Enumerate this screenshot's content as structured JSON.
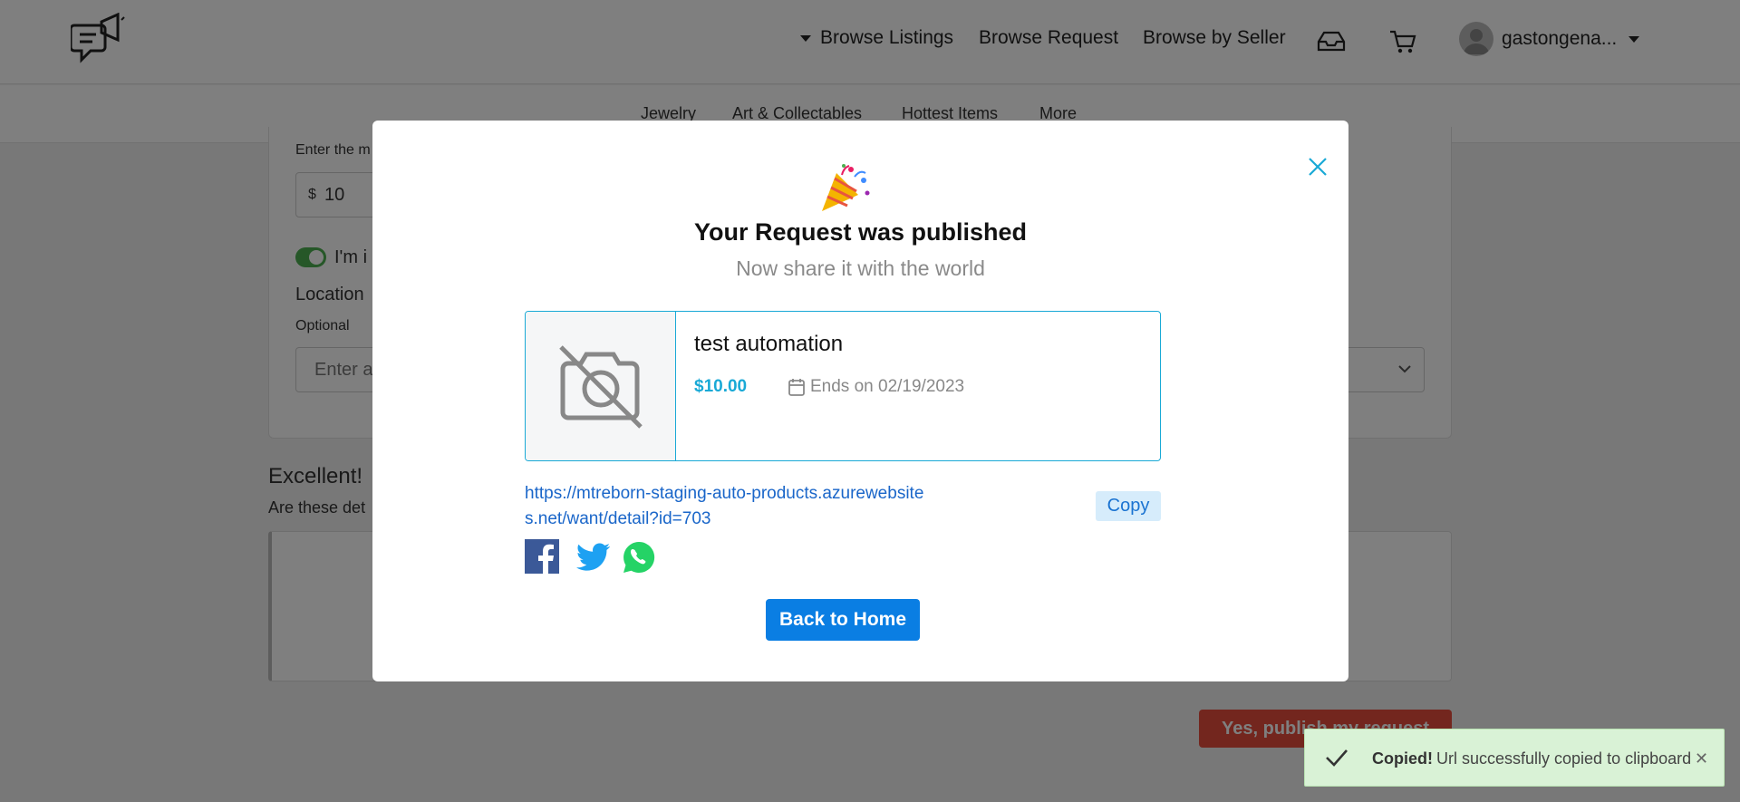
{
  "nav": {
    "browse_listings": "Browse Listings",
    "browse_request": "Browse Request",
    "browse_by_seller": "Browse by Seller",
    "user_name": "gastongena..."
  },
  "categories": [
    "Jewelry",
    "Art & Collectables",
    "Hottest Items",
    "More"
  ],
  "background_form": {
    "price_label": "Enter the m",
    "currency": "$",
    "price_value": "10",
    "toggle_label": "I'm i",
    "location_label": "Location",
    "location_hint": "Optional",
    "location_placeholder": "Enter a",
    "excellent": "Excellent!",
    "are_these": "Are these det",
    "publish_button": "Yes, publish my request"
  },
  "modal": {
    "title": "Your Request was published",
    "subtitle": "Now share it with the world",
    "item_title": "test automation",
    "item_price": "$10.00",
    "item_ends": "Ends on 02/19/2023",
    "share_url": "https://mtreborn-staging-auto-products.azurewebsites.net/want/detail?id=703",
    "copy_label": "Copy",
    "home_button": "Back to Home"
  },
  "toast": {
    "title": "Copied!",
    "message": "Url successfully copied to clipboard"
  },
  "colors": {
    "accent": "#19a9d6",
    "primary_button": "#0a7ee3",
    "toast_bg": "#d9f2d6",
    "publish_red": "#e74c3c"
  }
}
